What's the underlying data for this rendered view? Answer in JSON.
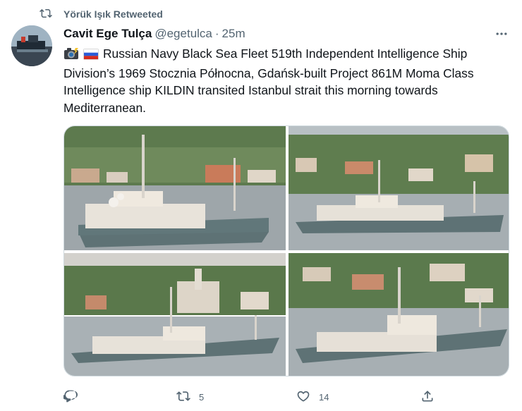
{
  "retweet_context": {
    "text": "Yörük Işık Retweeted"
  },
  "tweet": {
    "author_name": "Cavit Ege Tulça",
    "handle": "@egetulca",
    "separator": "·",
    "time": "25m",
    "text": "Russian Navy Black Sea Fleet 519th Independent Intelligence Ship Division’s 1969 Stocznia Północna, Gdańsk-built Project 861M Moma Class Intelligence ship KILDIN transited Istanbul strait this morning towards Mediterranean.",
    "emoji": [
      "camera-with-flash-emoji",
      "russia-flag-emoji"
    ]
  },
  "actions": {
    "replies": "",
    "retweets": "5",
    "likes": "14"
  },
  "colors": {
    "secondary_text": "#536471",
    "border": "#cfd9de",
    "ship_hull": "#5e7275"
  }
}
